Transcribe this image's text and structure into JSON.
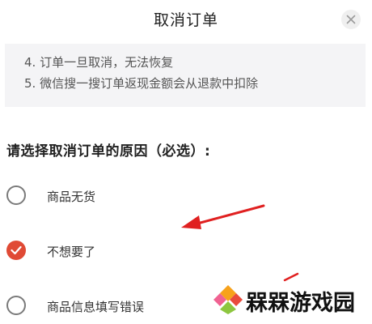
{
  "dialog": {
    "title": "取消订单",
    "notices": [
      "4. 订单一旦取消，无法恢复",
      "5. 微信搜一搜订单返现金额会从退款中扣除"
    ],
    "section_title": "请选择取消订单的原因（必选）:",
    "options": [
      {
        "label": "商品无货",
        "checked": false
      },
      {
        "label": "不想要了",
        "checked": true
      },
      {
        "label": "商品信息填写错误",
        "checked": false
      }
    ]
  },
  "watermark": {
    "text": "槑槑游戏园"
  },
  "colors": {
    "accent": "#e04a35",
    "notice_bg": "#f4f4f6",
    "annotation": "#e02020"
  },
  "icons": {
    "close": "close-icon",
    "check": "check-icon",
    "arrow": "annotation-arrow-icon",
    "logo": "watermark-logo-icon"
  }
}
